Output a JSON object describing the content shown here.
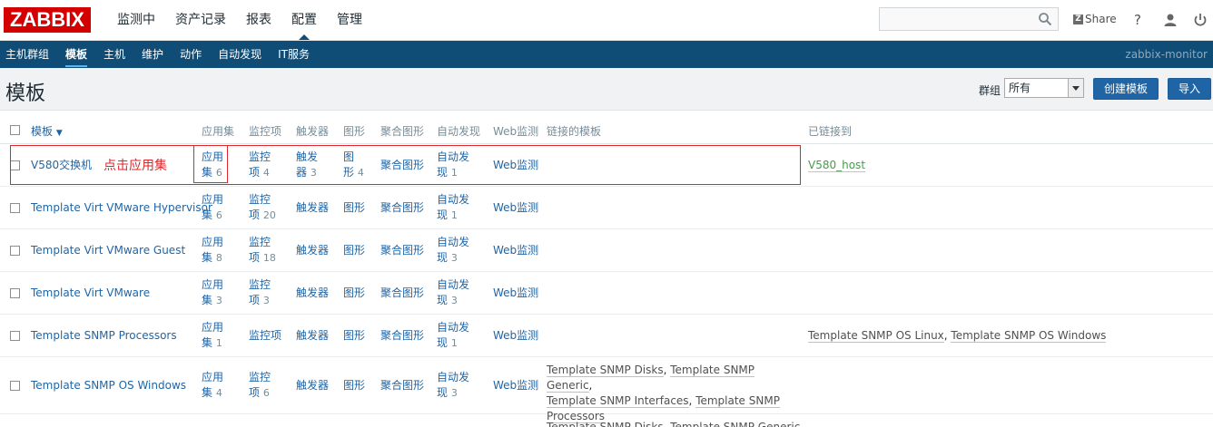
{
  "header": {
    "logo": "ZABBIX",
    "menu": [
      "监测中",
      "资产记录",
      "报表",
      "配置",
      "管理"
    ],
    "share": "Share",
    "share_z": "Z",
    "help": "?",
    "icons": [
      "search-icon",
      "user-icon",
      "power-icon"
    ]
  },
  "subnav": {
    "items": [
      "主机群组",
      "模板",
      "主机",
      "维护",
      "动作",
      "自动发现",
      "IT服务"
    ],
    "server": "zabbix-monitor"
  },
  "page": {
    "title": "模板",
    "group_label": "群组",
    "group_value": "所有",
    "create_button": "创建模板",
    "import_button": "导入"
  },
  "table": {
    "headers": {
      "name": "模板",
      "sort_arrow": "▼",
      "apps": "应用集",
      "items": "监控项",
      "triggers": "触发器",
      "graphs": "图形",
      "screens": "聚合图形",
      "discovery": "自动发现",
      "web": "Web监测",
      "linked": "链接的模板",
      "linked_to": "已链接到"
    },
    "rows": [
      {
        "name": "V580交换机",
        "apps": [
          "应用",
          "集",
          "6"
        ],
        "items": [
          "监控",
          "项",
          "4"
        ],
        "triggers": [
          "触发",
          "器",
          "3"
        ],
        "graphs": [
          "图",
          "形",
          "4"
        ],
        "screens": "聚合图形",
        "discovery": [
          "自动发",
          "现",
          "1"
        ],
        "web": "Web监测",
        "linked_to": [
          "V580_host"
        ]
      },
      {
        "name": "Template Virt VMware Hypervisor",
        "apps": [
          "应用",
          "集",
          "6"
        ],
        "items": [
          "监控",
          "项",
          "20"
        ],
        "triggers": "触发器",
        "graphs": "图形",
        "screens": "聚合图形",
        "discovery": [
          "自动发",
          "现",
          "1"
        ],
        "web": "Web监测"
      },
      {
        "name": "Template Virt VMware Guest",
        "apps": [
          "应用",
          "集",
          "8"
        ],
        "items": [
          "监控",
          "项",
          "18"
        ],
        "triggers": "触发器",
        "graphs": "图形",
        "screens": "聚合图形",
        "discovery": [
          "自动发",
          "现",
          "3"
        ],
        "web": "Web监测"
      },
      {
        "name": "Template Virt VMware",
        "apps": [
          "应用",
          "集",
          "3"
        ],
        "items": [
          "监控",
          "项",
          "3"
        ],
        "triggers": "触发器",
        "graphs": "图形",
        "screens": "聚合图形",
        "discovery": [
          "自动发",
          "现",
          "3"
        ],
        "web": "Web监测"
      },
      {
        "name": "Template SNMP Processors",
        "apps": [
          "应用",
          "集",
          "1"
        ],
        "items": "监控项",
        "triggers": "触发器",
        "graphs": "图形",
        "screens": "聚合图形",
        "discovery": [
          "自动发",
          "现",
          "1"
        ],
        "web": "Web监测",
        "linked_to": [
          "Template SNMP OS Linux",
          "Template SNMP OS Windows"
        ]
      },
      {
        "name": "Template SNMP OS Windows",
        "apps": [
          "应用",
          "集",
          "4"
        ],
        "items": [
          "监控",
          "项",
          "6"
        ],
        "triggers": "触发器",
        "graphs": "图形",
        "screens": "聚合图形",
        "discovery": [
          "自动发",
          "现",
          "3"
        ],
        "web": "Web监测",
        "linked": [
          "Template SNMP Disks",
          "Template SNMP Generic",
          "Template SNMP Interfaces",
          "Template SNMP",
          "Processors"
        ]
      }
    ],
    "partial_row_text": "Template SNMP Disks, Template SNMP Generic,"
  },
  "annotation": {
    "text": "点击应用集",
    "color": "#e0262a"
  },
  "colors": {
    "logo": "#d40000",
    "subnav": "#0f4d77",
    "link": "#1f65a6",
    "button": "#1f65a6",
    "linked_to": "#429e47"
  }
}
